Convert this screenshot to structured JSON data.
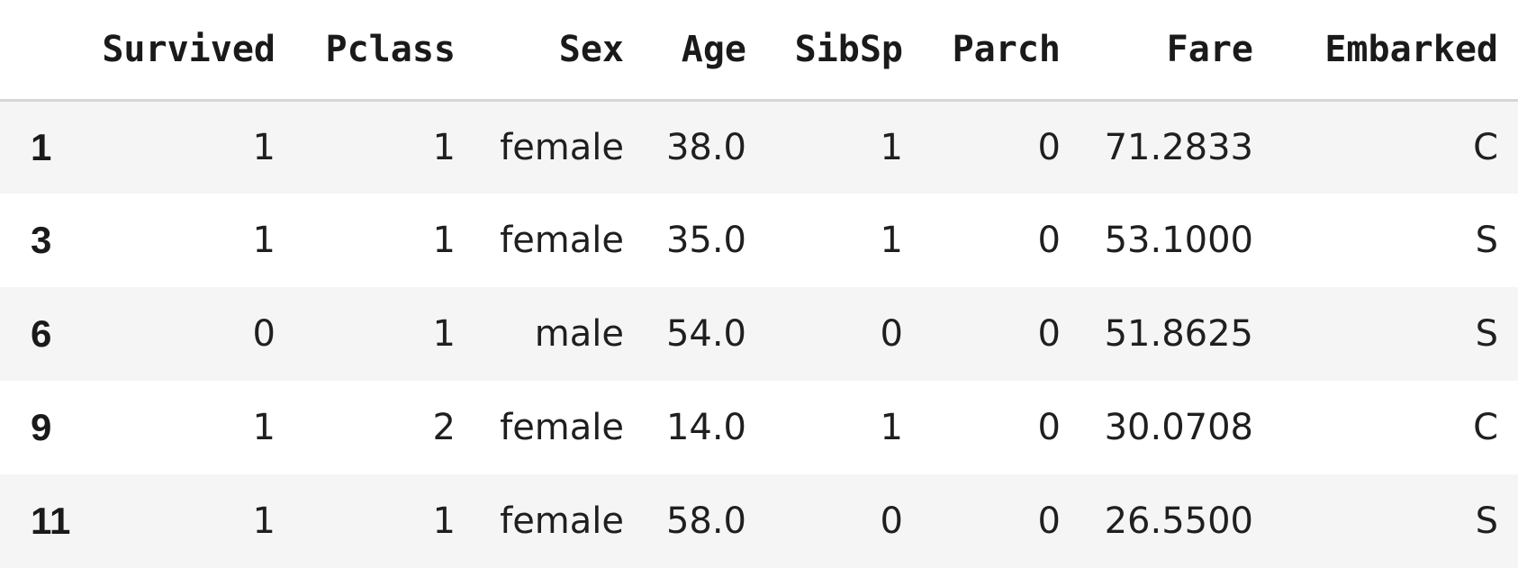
{
  "table": {
    "columns": [
      "",
      "Survived",
      "Pclass",
      "Sex",
      "Age",
      "SibSp",
      "Parch",
      "Fare",
      "Embarked"
    ],
    "rows": [
      {
        "index": "1",
        "cells": [
          "1",
          "1",
          "female",
          "38.0",
          "1",
          "0",
          "71.2833",
          "C"
        ]
      },
      {
        "index": "3",
        "cells": [
          "1",
          "1",
          "female",
          "35.0",
          "1",
          "0",
          "53.1000",
          "S"
        ]
      },
      {
        "index": "6",
        "cells": [
          "0",
          "1",
          "male",
          "54.0",
          "0",
          "0",
          "51.8625",
          "S"
        ]
      },
      {
        "index": "9",
        "cells": [
          "1",
          "2",
          "female",
          "14.0",
          "1",
          "0",
          "30.0708",
          "C"
        ]
      },
      {
        "index": "11",
        "cells": [
          "1",
          "1",
          "female",
          "58.0",
          "0",
          "0",
          "26.5500",
          "S"
        ]
      }
    ]
  },
  "colors": {
    "striped_row": "#f5f5f5",
    "header_rule": "#d6d6d6",
    "text": "#1a1a1a"
  }
}
